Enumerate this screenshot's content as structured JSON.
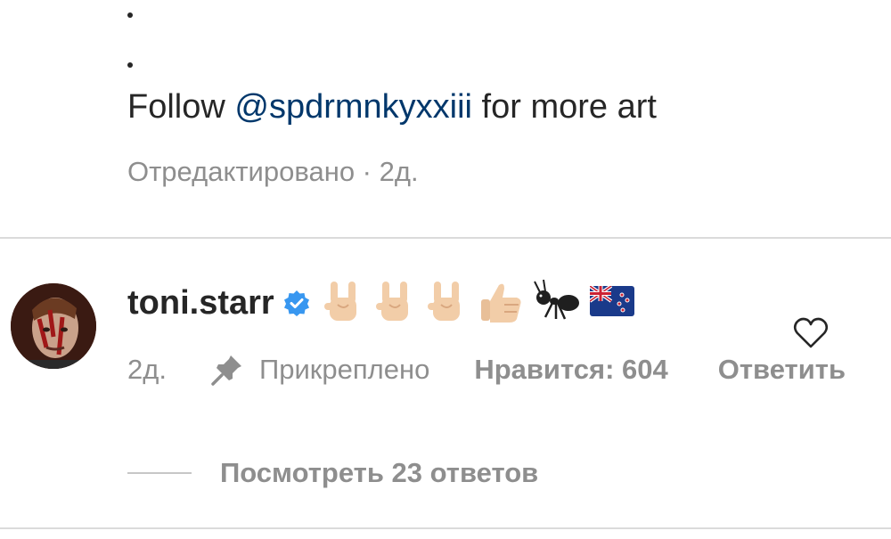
{
  "post": {
    "caption_prefix": "Follow ",
    "caption_mention": "@spdrmnkyxxiii",
    "caption_suffix": " for more art",
    "meta": "Отредактировано · 2д."
  },
  "comment": {
    "username": "toni.starr",
    "emojis": [
      "rock-on-hand",
      "rock-on-hand",
      "rock-on-hand",
      "thumbs-up",
      "ant",
      "flag-new-zealand"
    ],
    "time": "2д.",
    "pinned_label": "Прикреплено",
    "likes_label": "Нравится: 604",
    "reply_label": "Ответить",
    "view_replies": "Посмотреть 23 ответов"
  },
  "colors": {
    "text": "#262626",
    "mention": "#00376b",
    "muted": "#8e8e8e",
    "verified": "#3897f0",
    "divider": "#dbdbdb"
  }
}
